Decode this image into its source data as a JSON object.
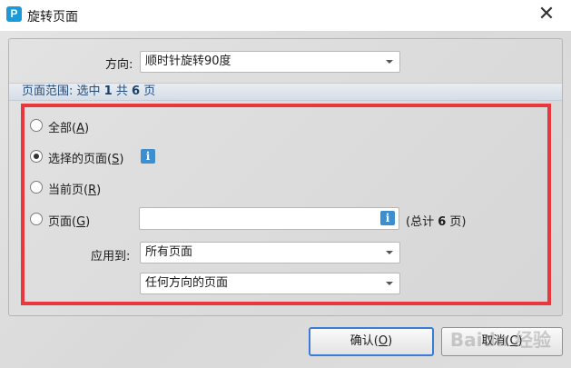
{
  "window": {
    "title": "旋转页面",
    "icon_letter": "P",
    "close_glyph": "✕"
  },
  "direction": {
    "label": "方向:",
    "value": "顺时针旋转90度"
  },
  "range_header": {
    "prefix": "页面范围: 选中",
    "selected": "1",
    "middle": "共",
    "total": "6",
    "suffix": "页"
  },
  "options": {
    "all": {
      "text": "全部(",
      "key": "A",
      "close": ")"
    },
    "selected": {
      "text": "选择的页面(",
      "key": "S",
      "close": ")"
    },
    "current": {
      "text": "当前页(",
      "key": "R",
      "close": ")"
    },
    "pages": {
      "text": "页面(",
      "key": "G",
      "close": ")"
    },
    "checked": "selected"
  },
  "pages_field": {
    "value": "",
    "total_prefix": "(总计",
    "total_num": "6",
    "total_suffix": "页)"
  },
  "apply_to": {
    "label": "应用到:",
    "value": "所有页面",
    "orientation_value": "任何方向的页面"
  },
  "buttons": {
    "ok": {
      "text": "确认(",
      "key": "O",
      "close": ")"
    },
    "cancel": {
      "text": "取消(",
      "key": "C",
      "close": ")"
    }
  },
  "info_glyph": "i",
  "watermark": "Baidu 经验",
  "colors": {
    "highlight_border": "#e8383d",
    "range_text": "#234d7a",
    "info_icon": "#3b8fd0",
    "default_button_border": "#3a7bd5"
  }
}
